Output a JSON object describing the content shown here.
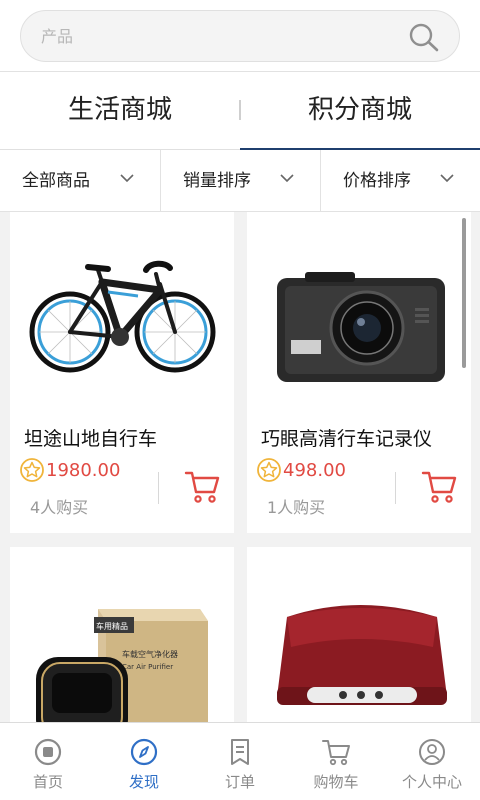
{
  "search": {
    "placeholder": "产品",
    "icon": "search-icon"
  },
  "mall_tabs": [
    {
      "label": "生活商城",
      "active": false
    },
    {
      "label": "积分商城",
      "active": true
    }
  ],
  "sort_bar": [
    {
      "label": "全部商品",
      "icon": "chevron-down-icon"
    },
    {
      "label": "销量排序",
      "icon": "chevron-down-icon"
    },
    {
      "label": "价格排序",
      "icon": "chevron-down-icon"
    }
  ],
  "products": [
    {
      "name": "坦途山地自行车",
      "price": "1980.00",
      "buyers": "4人购买",
      "image": "mountain-bike"
    },
    {
      "name": "巧眼高清行车记录仪",
      "price": "498.00",
      "buyers": "1人购买",
      "image": "dash-camera"
    },
    {
      "name": "",
      "price": "",
      "buyers": "",
      "image": "car-air-purifier",
      "box_label": "车用精品",
      "box_text_cn": "车载空气净化器",
      "box_text_en": "Car Air Purifier"
    },
    {
      "name": "",
      "price": "",
      "buyers": "",
      "image": "red-massager"
    }
  ],
  "bottom_nav": [
    {
      "label": "首页",
      "icon": "home-icon",
      "active": false
    },
    {
      "label": "发现",
      "icon": "compass-icon",
      "active": true
    },
    {
      "label": "订单",
      "icon": "order-icon",
      "active": false
    },
    {
      "label": "购物车",
      "icon": "cart-icon",
      "active": false
    },
    {
      "label": "个人中心",
      "icon": "profile-icon",
      "active": false
    }
  ],
  "colors": {
    "accent_blue": "#2f6fc6",
    "price_red": "#e14a43",
    "tab_underline": "#1f3f6e",
    "star_gold": "#f0b43a"
  }
}
